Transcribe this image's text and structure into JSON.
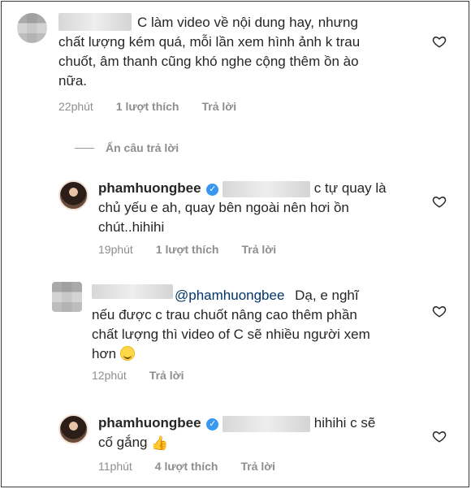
{
  "comments": [
    {
      "text_line1": "C làm video về nội dung hay, nhưng",
      "text_line2": "chất lượng kém quá, mỗi lần xem hình ảnh k trau",
      "text_line3": "chuốt, âm thanh cũng khó nghe cộng thêm ồn ào",
      "text_line4": "nữa.",
      "time": "22phút",
      "likes": "1 lượt thích",
      "reply": "Trả lời"
    },
    {
      "username": "phamhuongbee",
      "text_line1_suffix": "c tự quay là",
      "text_line2": "chủ yếu e ah, quay bên ngoài nên hơi ồn",
      "text_line3": "chút..hihihi",
      "time": "19phút",
      "likes": "1 lượt thích",
      "reply": "Trả lời"
    },
    {
      "mention": "@phamhuongbee",
      "text_line1_suffix": "Dạ, e nghĩ",
      "text_line2": "nếu được c trau chuốt nâng cao thêm phần",
      "text_line3": "chất lượng thì video of C sẽ nhiều người xem",
      "text_line4": "hơn",
      "time": "12phút",
      "reply": "Trả lời"
    },
    {
      "username": "phamhuongbee",
      "text_line1_suffix": "hihihi c sẽ",
      "text_line2": "cố gắng",
      "time": "11phút",
      "likes": "4 lượt thích",
      "reply": "Trả lời"
    }
  ],
  "hide_replies": "Ẩn câu trả lời",
  "icons": {
    "heart": "heart-outline-icon",
    "verified": "verified-badge-icon",
    "emoji": "smiley-emoji",
    "thumbs": "thumbs-up-emoji"
  },
  "verified_glyph": "✓",
  "thumbs_glyph": "👍"
}
